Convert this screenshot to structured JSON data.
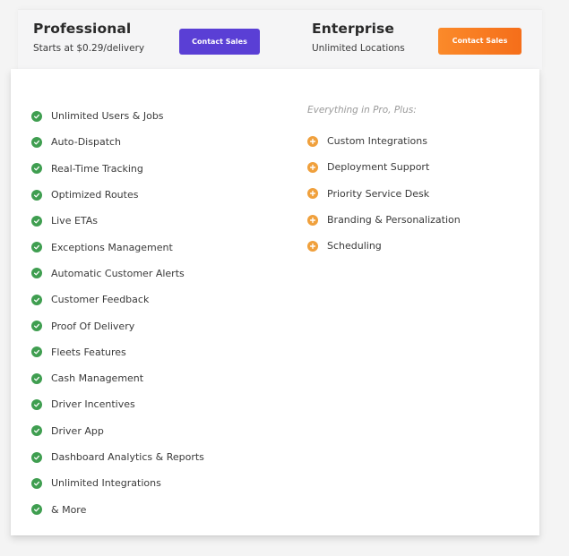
{
  "plans": {
    "professional": {
      "name": "Professional",
      "subtitle": "Starts at $0.29/delivery",
      "cta_label": "Contact Sales",
      "cta_color": "#5a3fd5"
    },
    "enterprise": {
      "name": "Enterprise",
      "subtitle": "Unlimited Locations",
      "cta_label": "Contact Sales",
      "cta_color": "#f97a1f"
    }
  },
  "features": {
    "professional": {
      "icon": "check-circle-icon",
      "icon_color": "#3f9e50",
      "items": [
        "Unlimited Users & Jobs",
        "Auto-Dispatch",
        "Real-Time Tracking",
        "Optimized Routes",
        "Live ETAs",
        "Exceptions Management",
        "Automatic Customer Alerts",
        "Customer Feedback",
        "Proof Of Delivery",
        "Fleets Features",
        "Cash Management",
        "Driver Incentives",
        "Driver App",
        "Dashboard Analytics & Reports",
        "Unlimited Integrations",
        "& More"
      ]
    },
    "enterprise": {
      "intro": "Everything in Pro, Plus:",
      "icon": "plus-circle-icon",
      "icon_color": "#f0a03c",
      "items": [
        "Custom Integrations",
        "Deployment Support",
        "Priority Service Desk",
        "Branding & Personalization",
        "Scheduling"
      ]
    }
  }
}
